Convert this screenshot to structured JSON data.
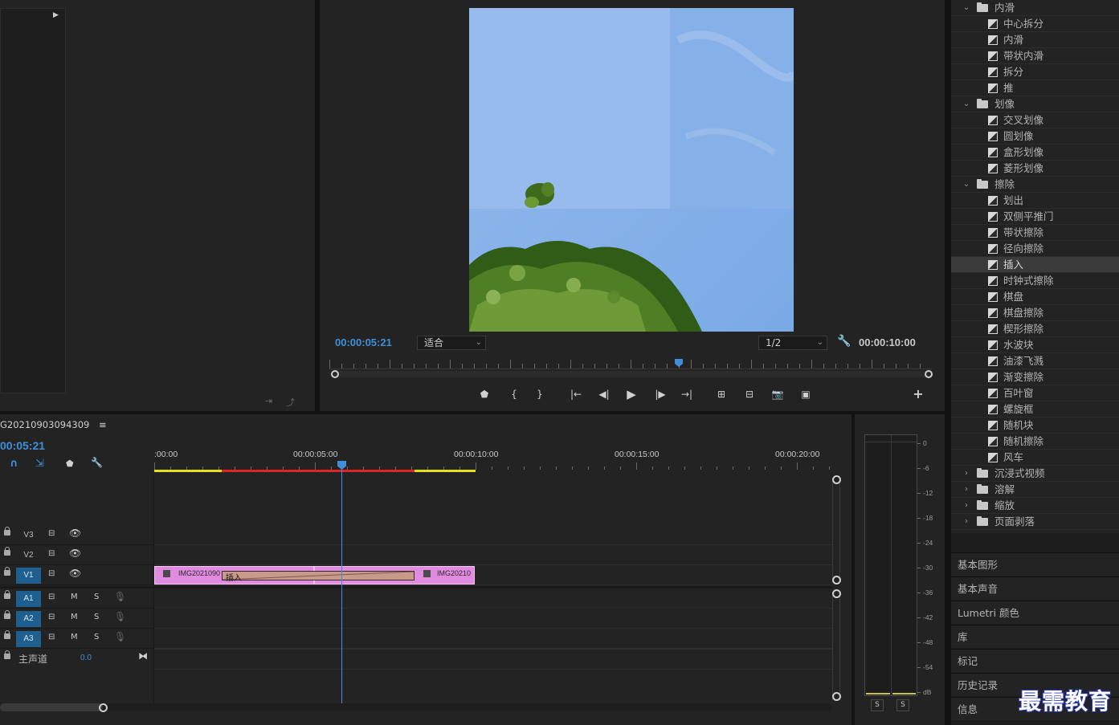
{
  "project": {
    "sequence_name": "G20210903094309",
    "menu_icon": "hamburger-icon"
  },
  "monitor": {
    "current_tc": "00:00:05:21",
    "fit_value": "适合",
    "resolution_value": "1/2",
    "duration_tc": "00:00:10:00",
    "playhead_fraction": 0.5815
  },
  "effects": {
    "rows": [
      {
        "kind": "folder",
        "open": true,
        "label": "内滑"
      },
      {
        "kind": "fx",
        "label": "中心拆分"
      },
      {
        "kind": "fx",
        "label": "内滑"
      },
      {
        "kind": "fx",
        "label": "带状内滑"
      },
      {
        "kind": "fx",
        "label": "拆分"
      },
      {
        "kind": "fx",
        "label": "推"
      },
      {
        "kind": "folder",
        "open": true,
        "label": "划像"
      },
      {
        "kind": "fx",
        "label": "交叉划像"
      },
      {
        "kind": "fx",
        "label": "圆划像"
      },
      {
        "kind": "fx",
        "label": "盒形划像"
      },
      {
        "kind": "fx",
        "label": "菱形划像"
      },
      {
        "kind": "folder",
        "open": true,
        "label": "擦除"
      },
      {
        "kind": "fx",
        "label": "划出"
      },
      {
        "kind": "fx",
        "label": "双侧平推门"
      },
      {
        "kind": "fx",
        "label": "带状擦除"
      },
      {
        "kind": "fx",
        "label": "径向擦除"
      },
      {
        "kind": "fx",
        "label": "插入",
        "selected": true
      },
      {
        "kind": "fx",
        "label": "时钟式擦除"
      },
      {
        "kind": "fx",
        "label": "棋盘"
      },
      {
        "kind": "fx",
        "label": "棋盘擦除"
      },
      {
        "kind": "fx",
        "label": "楔形擦除"
      },
      {
        "kind": "fx",
        "label": "水波块"
      },
      {
        "kind": "fx",
        "label": "油漆飞溅"
      },
      {
        "kind": "fx",
        "label": "渐变擦除"
      },
      {
        "kind": "fx",
        "label": "百叶窗"
      },
      {
        "kind": "fx",
        "label": "螺旋框"
      },
      {
        "kind": "fx",
        "label": "随机块"
      },
      {
        "kind": "fx",
        "label": "随机擦除"
      },
      {
        "kind": "fx",
        "label": "风车"
      },
      {
        "kind": "folder",
        "open": false,
        "label": "沉浸式视频"
      },
      {
        "kind": "folder",
        "open": false,
        "label": "溶解"
      },
      {
        "kind": "folder",
        "open": false,
        "label": "缩放"
      },
      {
        "kind": "folder",
        "open": false,
        "label": "页面剥落"
      }
    ]
  },
  "side_panels": [
    "基本图形",
    "基本声音",
    "Lumetri 颜色",
    "库",
    "标记",
    "历史记录",
    "信息"
  ],
  "timeline": {
    "current_tc": "00:05:21",
    "ruler": [
      ":00:00",
      "00:00:05:00",
      "00:00:10:00",
      "00:00:15:00",
      "00:00:20:00"
    ],
    "tracks_video": [
      {
        "name": "V3",
        "targeted": false
      },
      {
        "name": "V2",
        "targeted": false
      },
      {
        "name": "V1",
        "targeted": true
      }
    ],
    "tracks_audio": [
      {
        "name": "A1",
        "targeted": true,
        "m": "M",
        "s": "S"
      },
      {
        "name": "A2",
        "targeted": true,
        "m": "M",
        "s": "S"
      },
      {
        "name": "A3",
        "targeted": true,
        "m": "M",
        "s": "S"
      }
    ],
    "master_label": "主声道",
    "master_value": "0.0",
    "clip_a": "IMG2021090",
    "clip_b": "IMG20210",
    "transition": "插入",
    "clip_color": "#e08be0",
    "transition_color": "#c79a8b",
    "playhead_color": "#3f8fd8"
  },
  "meter": {
    "db_labels": [
      "0",
      "-6",
      "-12",
      "-18",
      "-24",
      "-30",
      "-36",
      "-42",
      "-48",
      "-54",
      "dB"
    ],
    "solo_left": "S",
    "solo_right": "S"
  },
  "watermark": "最需教育"
}
